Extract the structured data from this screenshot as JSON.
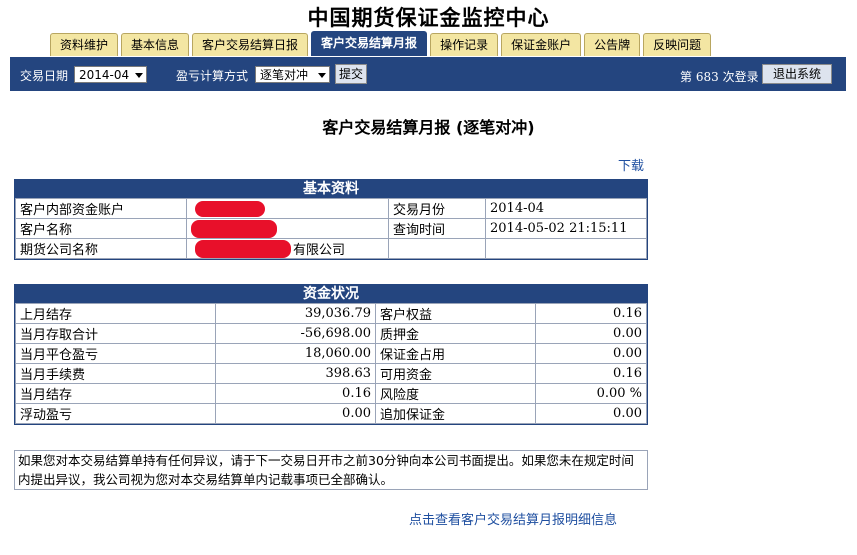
{
  "header": {
    "site_title": "中国期货保证金监控中心"
  },
  "tabs": [
    {
      "label": "资料维护",
      "active": false
    },
    {
      "label": "基本信息",
      "active": false
    },
    {
      "label": "客户交易结算日报",
      "active": false
    },
    {
      "label": "客户交易结算月报",
      "active": true
    },
    {
      "label": "操作记录",
      "active": false
    },
    {
      "label": "保证金账户",
      "active": false
    },
    {
      "label": "公告牌",
      "active": false
    },
    {
      "label": "反映问题",
      "active": false
    }
  ],
  "toolbar": {
    "date_label": "交易日期",
    "date_value": "2014-04",
    "calc_label": "盈亏计算方式",
    "calc_value": "逐笔对冲",
    "submit_label": "提交",
    "login_prefix": "第",
    "login_count": "683",
    "login_suffix": "次登录",
    "logout_label": "退出系统"
  },
  "report": {
    "title": "客户交易结算月报 (逐笔对冲)",
    "download_label": "下载"
  },
  "basic": {
    "heading": "基本资料",
    "account_label": "客户内部资金账户",
    "account_value": "",
    "month_label": "交易月份",
    "month_value": "2014-04",
    "name_label": "客户名称",
    "name_value": "",
    "query_time_label": "查询时间",
    "query_time_value": "2014-05-02 21:15:11",
    "company_label": "期货公司名称",
    "company_value": "有限公司"
  },
  "funds": {
    "heading": "资金状况",
    "rows": [
      {
        "l_label": "上月结存",
        "l_value": "39,036.79",
        "r_label": "客户权益",
        "r_value": "0.16"
      },
      {
        "l_label": "当月存取合计",
        "l_value": "-56,698.00",
        "r_label": "质押金",
        "r_value": "0.00"
      },
      {
        "l_label": "当月平仓盈亏",
        "l_value": "18,060.00",
        "r_label": "保证金占用",
        "r_value": "0.00"
      },
      {
        "l_label": "当月手续费",
        "l_value": "398.63",
        "r_label": "可用资金",
        "r_value": "0.16"
      },
      {
        "l_label": "当月结存",
        "l_value": "0.16",
        "r_label": "风险度",
        "r_value": "0.00 %"
      },
      {
        "l_label": "浮动盈亏",
        "l_value": "0.00",
        "r_label": "追加保证金",
        "r_value": "0.00"
      }
    ]
  },
  "notice": {
    "text": "如果您对本交易结算单持有任何异议，请于下一交易日开市之前30分钟向本公司书面提出。如果您未在规定时间内提出异议，我公司视为您对本交易结算单内记载事项已全部确认。"
  },
  "footer": {
    "detail_link": "点击查看客户交易结算月报明细信息"
  },
  "colors": {
    "nav_blue": "#24457f",
    "tab_yellow": "#f3e6a3",
    "link_blue": "#1f4fa0",
    "redaction_red": "#e8102a"
  }
}
